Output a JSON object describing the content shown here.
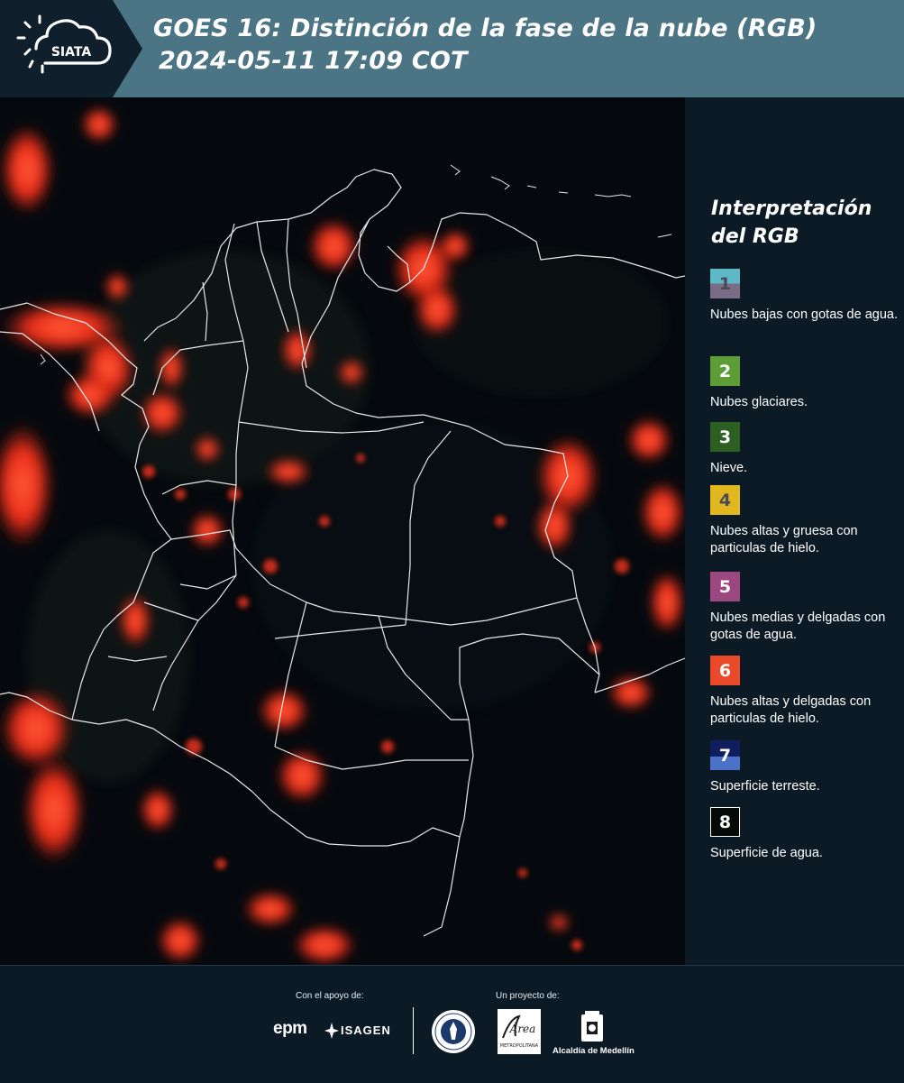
{
  "header": {
    "logo_text": "SIATA",
    "title_line1": "GOES 16: Distinción de la fase de la nube (RGB)",
    "title_line2": "2024-05-11 17:09 COT",
    "background_color": "#4b7484",
    "logo_background_color": "#0f1f2b"
  },
  "legend": {
    "title": "Interpretación del RGB",
    "items": [
      {
        "number": "1",
        "description": "Nubes bajas con gotas de agua.",
        "color_top": "#5fb8c6",
        "color_bottom": "#7a6c87",
        "number_color": "#4a4a55"
      },
      {
        "number": "2",
        "description": "Nubes glaciares.",
        "color_top": "#5c9e35",
        "color_bottom": "#5c9e35",
        "number_color": "#ffffff"
      },
      {
        "number": "3",
        "description": "Nieve.",
        "color_top": "#2d5e22",
        "color_bottom": "#2d5e22",
        "number_color": "#ffffff"
      },
      {
        "number": "4",
        "description": "Nubes altas y gruesa con particulas de hielo.",
        "color_top": "#e1b81f",
        "color_bottom": "#e1b81f",
        "number_color": "#4a4a55"
      },
      {
        "number": "5",
        "description": "Nubes medias y delgadas con gotas de agua.",
        "color_top": "#9c4880",
        "color_bottom": "#9c4880",
        "number_color": "#ffffff"
      },
      {
        "number": "6",
        "description": "Nubes altas y delgadas con particulas de hielo.",
        "color_top": "#ea4a2a",
        "color_bottom": "#ea4a2a",
        "number_color": "#ffffff"
      },
      {
        "number": "7",
        "description": "Superficie terreste.",
        "color_top": "#0f1e5e",
        "color_bottom": "#4a72c9",
        "number_color": "#ffffff"
      },
      {
        "number": "8",
        "description": "Superficie de agua.",
        "color_top": "#050a06",
        "color_bottom": "#050a06",
        "number_color": "#ffffff"
      }
    ]
  },
  "footer": {
    "support_label": "Con el apoyo de:",
    "project_label": "Un proyecto de:",
    "sponsor_1": "epm",
    "sponsor_2": "ISAGEN",
    "partner_1_text": "Área",
    "partner_1_subtext": "METROPOLITANA",
    "partner_2": "Alcaldía de Medellín"
  },
  "map": {
    "cloud_color": "#ff3a22",
    "background_color": "#05090d",
    "border_color": "#e8e8e8"
  }
}
